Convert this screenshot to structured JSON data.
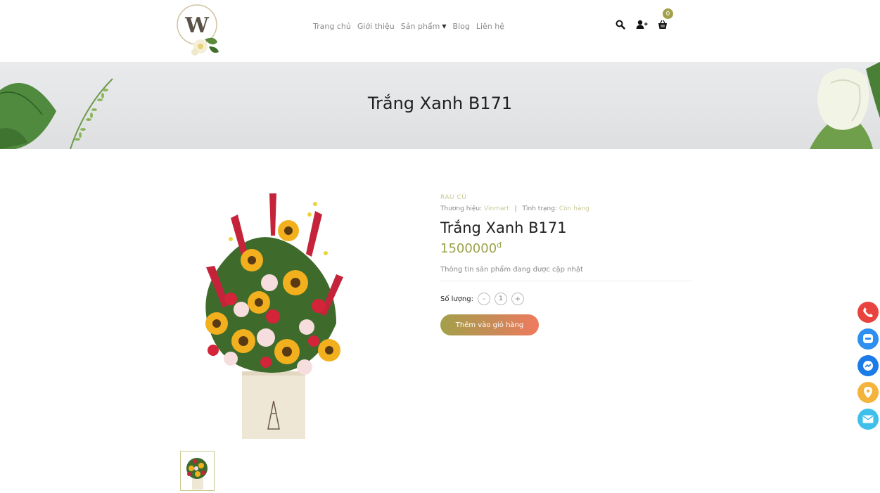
{
  "header": {
    "logo_letter": "W",
    "nav": [
      {
        "label": "Trang chủ"
      },
      {
        "label": "Giới thiệu"
      },
      {
        "label": "Sản phẩm"
      },
      {
        "label": "Blog"
      },
      {
        "label": "Liên hệ"
      }
    ],
    "cart_count": "0",
    "icons": [
      "search-icon",
      "user-add-icon",
      "cart-icon"
    ]
  },
  "banner": {
    "title": "Trắng Xanh B171"
  },
  "product": {
    "category": "RAU CỦ",
    "brand_label": "Thương hiệu:",
    "brand_value": "Vinmart",
    "separator": "|",
    "status_label": "Tình trạng:",
    "status_value": "Còn hàng",
    "title": "Trắng Xanh B171",
    "price": "1500000",
    "currency": "đ",
    "description": "Thông tin sản phẩm đang được cập nhật",
    "quantity_label": "Số lượng:",
    "quantity_minus": "-",
    "quantity_value": "1",
    "quantity_plus": "+",
    "add_to_cart": "Thêm vào giỏ hàng"
  },
  "floating_contacts": [
    {
      "icon": "phone-icon",
      "color": "#e8433e"
    },
    {
      "icon": "zalo-icon",
      "color": "#2d8ff0"
    },
    {
      "icon": "messenger-icon",
      "color": "#1c7be6"
    },
    {
      "icon": "map-pin-icon",
      "color": "#f4b33a"
    },
    {
      "icon": "mail-icon",
      "color": "#3fc0ea"
    }
  ],
  "colors": {
    "accent": "#a3a04a",
    "button_gradient_end": "#ef7a5e",
    "text_muted": "#8a8a8a"
  }
}
